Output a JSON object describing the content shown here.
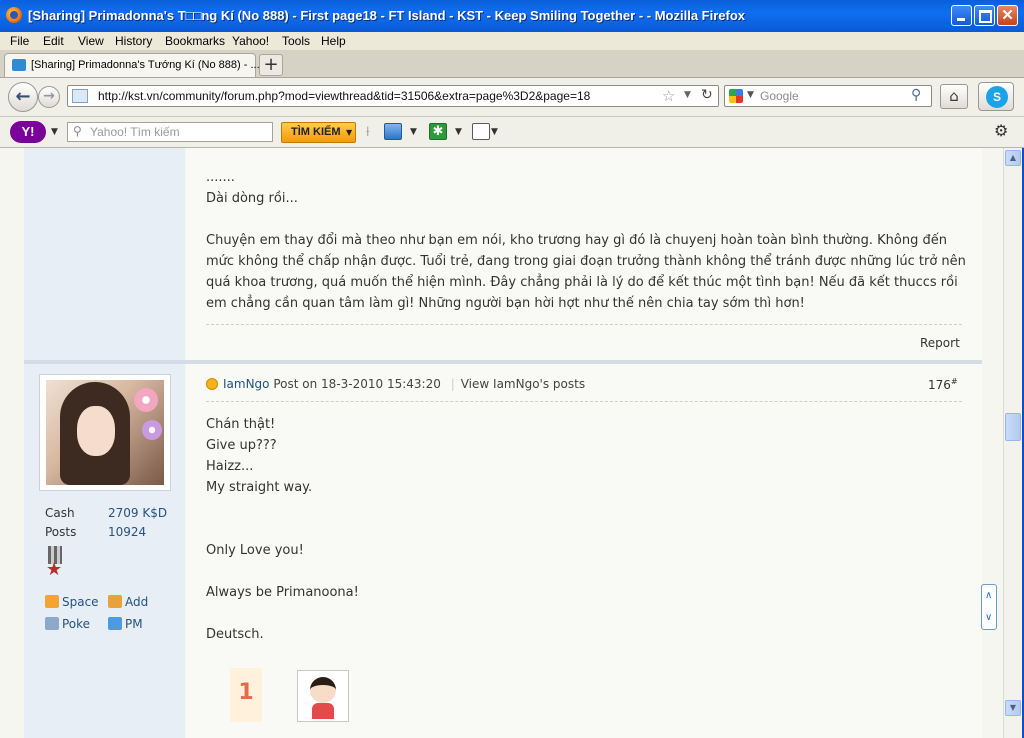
{
  "window": {
    "title": "[Sharing] Primadonna's T□□ng Kí (No 888) - First page18 - FT Island - KST - Keep Smiling Together - - Mozilla Firefox"
  },
  "menu": [
    "File",
    "Edit",
    "View",
    "History",
    "Bookmarks",
    "Yahoo!",
    "Tools",
    "Help"
  ],
  "tab": {
    "label": "[Sharing] Primadonna's Tướng Kí (No 888) - ...",
    "new_tab": "+"
  },
  "nav": {
    "url": "http://kst.vn/community/forum.php?mod=viewthread&tid=31506&extra=page%3D2&page=18",
    "search_placeholder": "Google"
  },
  "yahoo": {
    "logo": "Y!",
    "search_placeholder": "Yahoo! Tìm kiếm",
    "search_button": "TÌM KIẾM"
  },
  "prev_post": {
    "lines_top": [
      "......."
    ],
    "line2": "Dài dòng rồi...",
    "paragraph": "Chuyện em thay đổi mà theo như bạn em nói, kho trương hay gì đó là chuyenj hoàn toàn bình thường. Không đến mức không thể chấp nhận được. Tuổi trẻ, đang trong giai đoạn trưởng thành không thể tránh được những lúc trở nên quá khoa trương, quá muốn thể hiện mình. Đây chẳng phải là lý do để kết thúc một tình bạn! Nếu đã kết thuccs rồi em chẳng cần quan tâm làm gì! Những người bạn hời hợt như thế nên chia tay sớm thì hơn!",
    "report": "Report"
  },
  "user": {
    "cash_label": "Cash",
    "cash_value": "2709 K$D",
    "posts_label": "Posts",
    "posts_value": "10924",
    "links": {
      "space": "Space",
      "add": "Add",
      "poke": "Poke",
      "pm": "PM"
    }
  },
  "post": {
    "author": "IamNgo",
    "post_on": "Post on 18-3-2010 15:43:20",
    "view_posts": "View IamNgo's posts",
    "floor": "176",
    "floor_sup": "#",
    "lines": [
      "Chán thật!",
      "Give up???",
      "Haizz...",
      "My straight way."
    ],
    "line_love": "Only Love you!",
    "line_always": "Always be Primanoona!",
    "line_deutsch": "Deutsch.",
    "thumb_number": "1"
  },
  "floatnav": {
    "top": "∧",
    "bottom": "∨"
  }
}
